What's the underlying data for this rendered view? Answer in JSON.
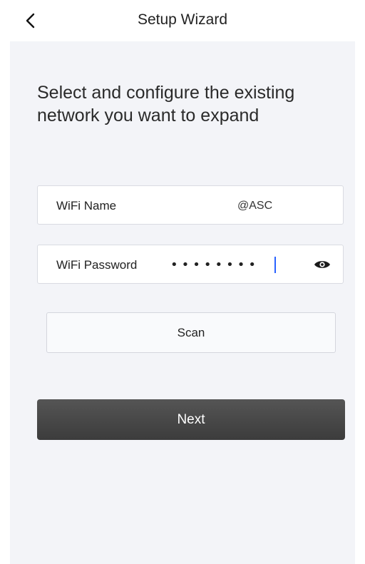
{
  "header": {
    "title": "Setup Wizard",
    "back_icon": "chevron-left-icon"
  },
  "main": {
    "headline": "Select and configure the existing network you want to expand",
    "wifi_name": {
      "label": "WiFi Name",
      "value": "@ASC"
    },
    "wifi_password": {
      "label": "WiFi Password",
      "value": "••••••••",
      "toggle_icon": "eye-icon"
    },
    "scan_label": "Scan",
    "next_label": "Next"
  },
  "colors": {
    "background": "#ffffff",
    "panel": "#f3f4f8",
    "primary_button": "#474747",
    "caret": "#2962ff"
  }
}
